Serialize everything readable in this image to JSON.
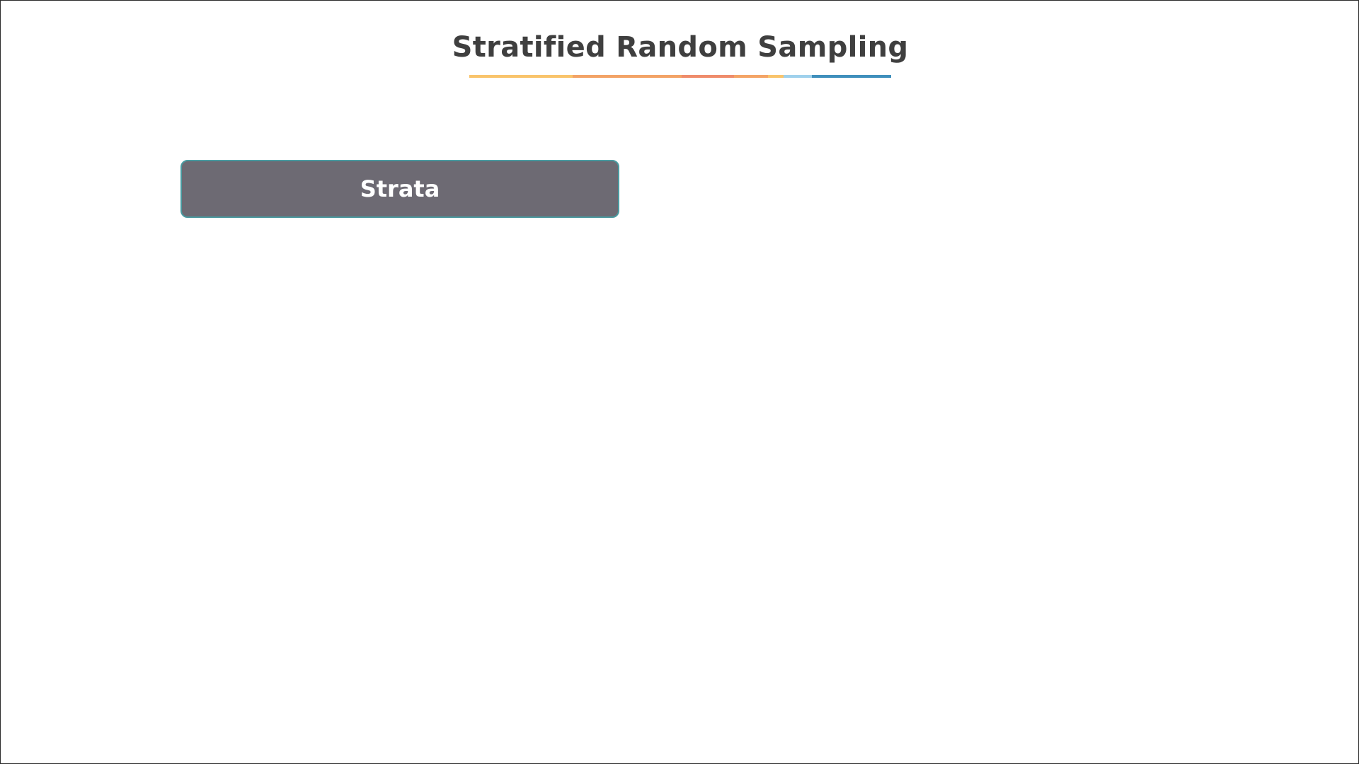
{
  "slide": {
    "title": "Stratified Random Sampling",
    "underline_colors": [
      "#f9c46b",
      "#f3a366",
      "#ef8c6b",
      "#f4a466",
      "#f9c46b",
      "#9fd1ec",
      "#3f8fbc"
    ],
    "background_color": "#ffffff"
  },
  "diagram": {
    "strata_label": "Strata",
    "strata_fill": "#6d6a73",
    "strata_border": "#4a9aa0"
  }
}
